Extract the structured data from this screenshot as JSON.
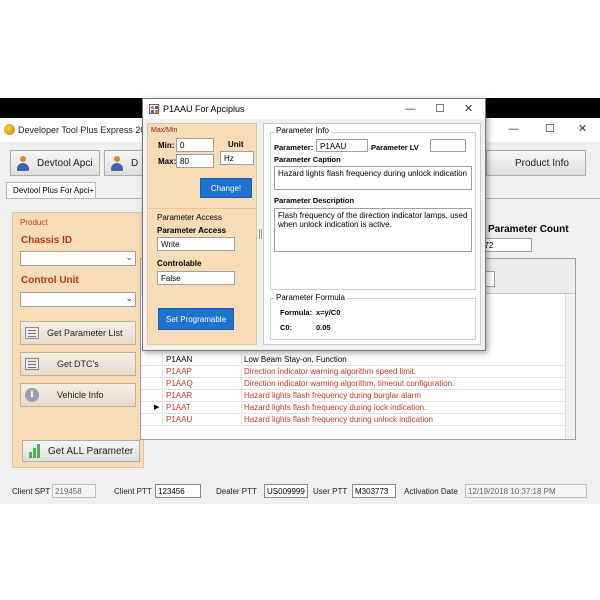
{
  "main": {
    "title": "Developer Tool Plus Express 2018",
    "controls": {
      "minimize": "—",
      "maximize": "☐",
      "close": "✕"
    },
    "devtool_btn": "Devtool Apci",
    "second_btn": "D",
    "product_info_btn": "Product Info",
    "tab": "Devtool Plus For Apci+"
  },
  "product": {
    "title": "Product",
    "chassis_label": "Chassis ID",
    "control_unit_label": "Control Unit",
    "get_parameter_list": "Get Parameter List",
    "get_dtcs": "Get DTC's",
    "vehicle_info": "Vehicle Info",
    "get_all_parameter": "Get ALL Parameter"
  },
  "param_count": {
    "label": "Parameter Count",
    "value": "672"
  },
  "table": {
    "rows": [
      {
        "code": "P1AAN",
        "desc": "Low Beam Stay-on, Function",
        "color": "#000000",
        "selected": false
      },
      {
        "code": "P1AAP",
        "desc": "Direction indicator warning algorithm speed limit.",
        "color": "#c0392b",
        "selected": false
      },
      {
        "code": "P1AAQ",
        "desc": "Direction indicator warning algorithm, timeout configuration.",
        "color": "#c0392b",
        "selected": false
      },
      {
        "code": "P1AAR",
        "desc": "Hazard lights flash frequency during burglar alarm",
        "color": "#c0392b",
        "selected": false
      },
      {
        "code": "P1AAT",
        "desc": "Hazard lights flash frequency during lock indication.",
        "color": "#c0392b",
        "selected": true
      },
      {
        "code": "P1AAU",
        "desc": "Hazard lights flash frequency during unlock indication",
        "color": "#c0392b",
        "selected": false
      }
    ],
    "selected_marker": "▶"
  },
  "status": {
    "client_spt_label": "Client SPT",
    "client_spt": "219458",
    "client_ptt_label": "Client PTT",
    "client_ptt": "123456",
    "dealer_ptt_label": "Dealer PTT",
    "dealer_ptt": "US009999",
    "user_ptt_label": "User PTT",
    "user_ptt": "M303773",
    "activation_label": "Activation Date",
    "activation_date": "12/19/2018 10:37:18 PM"
  },
  "dialog": {
    "title": "P1AAU For Apciplus",
    "controls": {
      "minimize": "—",
      "maximize": "☐",
      "close": "✕"
    },
    "maxmin_title": "Max/Min",
    "min_label": "Min:",
    "min_value": "0",
    "max_label": "Max:",
    "max_value": "80",
    "unit_label": "Unit",
    "unit_value": "Hz",
    "change_btn": "Change!",
    "access_title": "Parameter Access",
    "access_label": "Parameter Access",
    "access_value": "Write",
    "controlable_label": "Controlable",
    "controlable_value": "False",
    "set_programable": "Set Programable",
    "info_title": "Parameter Info",
    "parameter_label": "Parameter:",
    "parameter_value": "P1AAU",
    "lv_label": "Parameter LV",
    "lv_value": "",
    "caption_label": "Parameter Caption",
    "caption_value": "Hazard lights flash frequency during unlock indication",
    "description_label": "Parameter Description",
    "description_value": "Flash frequency of the direction indicator lamps, used when unlock indication is active.",
    "formula_title": "Parameter Formula",
    "formula_label": "Formula:",
    "formula_value": "x=y/C0",
    "c0_label": "C0:",
    "c0_value": "0.05"
  }
}
